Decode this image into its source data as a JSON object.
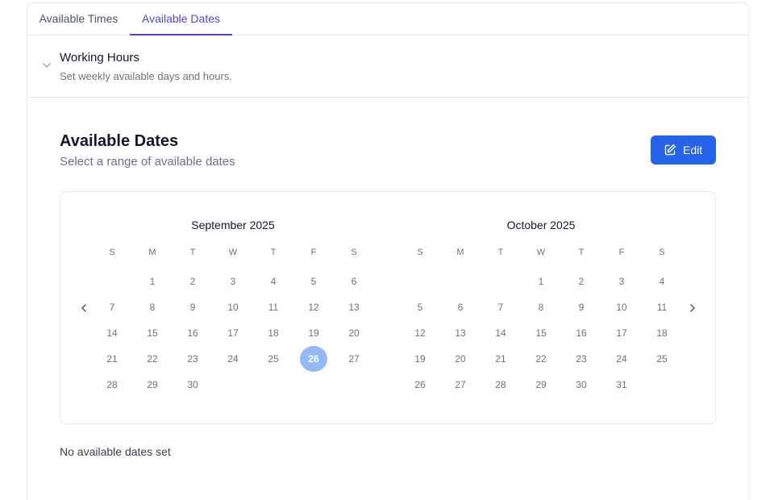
{
  "tabs": [
    {
      "label": "Available Times",
      "active": false
    },
    {
      "label": "Available Dates",
      "active": true
    }
  ],
  "working_hours": {
    "title": "Working Hours",
    "subtitle": "Set weekly available days and hours.",
    "icon": "chevron-down-icon"
  },
  "section": {
    "title": "Available Dates",
    "subtitle": "Select a range of available dates"
  },
  "edit_button": {
    "label": "Edit",
    "icon": "edit-icon",
    "color": "#2563eb"
  },
  "calendar": {
    "prev_icon": "chevron-left-icon",
    "next_icon": "chevron-right-icon",
    "weekdays": [
      "S",
      "M",
      "T",
      "W",
      "T",
      "F",
      "S"
    ],
    "months": [
      {
        "title": "September 2025",
        "first_weekday": 1,
        "days": 30,
        "selected": 26
      },
      {
        "title": "October 2025",
        "first_weekday": 3,
        "days": 31,
        "selected": null
      }
    ],
    "selected_color": "#93b9f7"
  },
  "empty_state": "No available dates set"
}
